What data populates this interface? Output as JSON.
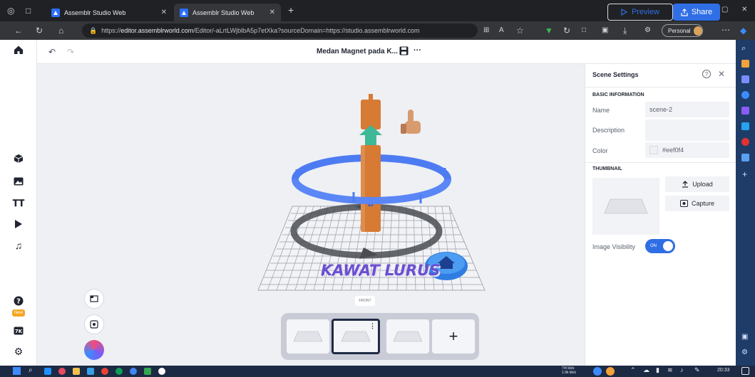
{
  "browser": {
    "tabs": [
      {
        "label": "Assemblr Studio Web",
        "active": false
      },
      {
        "label": "Assemblr Studio Web",
        "active": true
      }
    ],
    "new_tab_glyph": "+",
    "url_prefix": "https://",
    "url_host": "editor.assemblrworld.com",
    "url_rest": "/Editor/-aLrtLWjblbA5p7etXka?sourceDomain=https://studio.assemblrworld.com",
    "profile_label": "Personal"
  },
  "header": {
    "project_title": "Medan Magnet pada K...",
    "more_glyph": "···",
    "preview_label": "Preview",
    "share_label": "Share"
  },
  "left_rail": {
    "items": [
      "home-icon",
      "cube-icon",
      "image-icon",
      "text-icon",
      "play-icon",
      "music-icon"
    ],
    "new_badge": "New"
  },
  "scene": {
    "label_3d_text": "KAWAT LURUS",
    "view_label": "FRONT"
  },
  "panel": {
    "title": "Scene Settings",
    "basic_info_heading": "BASIC INFORMATION",
    "name_label": "Name",
    "name_value": "scene-2",
    "description_label": "Description",
    "description_value": "",
    "color_label": "Color",
    "color_value": "#eef0f4",
    "thumbnail_heading": "THUMBNAIL",
    "upload_label": "Upload",
    "capture_label": "Capture",
    "image_visibility_label": "Image Visibility",
    "toggle_state": "ON"
  },
  "scenes_strip": {
    "add_glyph": "+"
  },
  "taskbar": {
    "clock": "20:33",
    "net_up": "7/4 kb/s",
    "net_down": "1.9k kb/s"
  },
  "colors": {
    "accent": "#2f6ee5",
    "ring": "#4d7bf2",
    "rod": "#d67a34",
    "arrow": "#3fb897",
    "title_text": "#7b5ad8"
  }
}
